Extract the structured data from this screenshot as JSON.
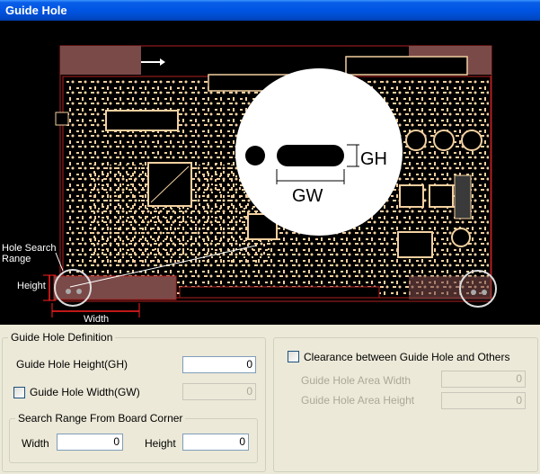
{
  "window": {
    "title": "Guide Hole"
  },
  "preview": {
    "gh_label": "GH",
    "gw_label": "GW",
    "hole_search_range_label": "Hole Search Range",
    "height_label": "Height",
    "width_label": "Width"
  },
  "definition": {
    "group_title": "Guide Hole Definition",
    "height_label": "Guide Hole Height(GH)",
    "height_value": "0",
    "width_label": "Guide Hole Width(GW)",
    "width_checked": false,
    "width_value": "0",
    "search_range": {
      "group_title": "Search Range From Board Corner",
      "width_label": "Width",
      "width_value": "0",
      "height_label": "Height",
      "height_value": "0"
    }
  },
  "clearance": {
    "checkbox_label": "Clearance between Guide Hole and Others",
    "checked": false,
    "area_width_label": "Guide Hole Area Width",
    "area_width_value": "0",
    "area_height_label": "Guide Hole Area Height",
    "area_height_value": "0"
  }
}
